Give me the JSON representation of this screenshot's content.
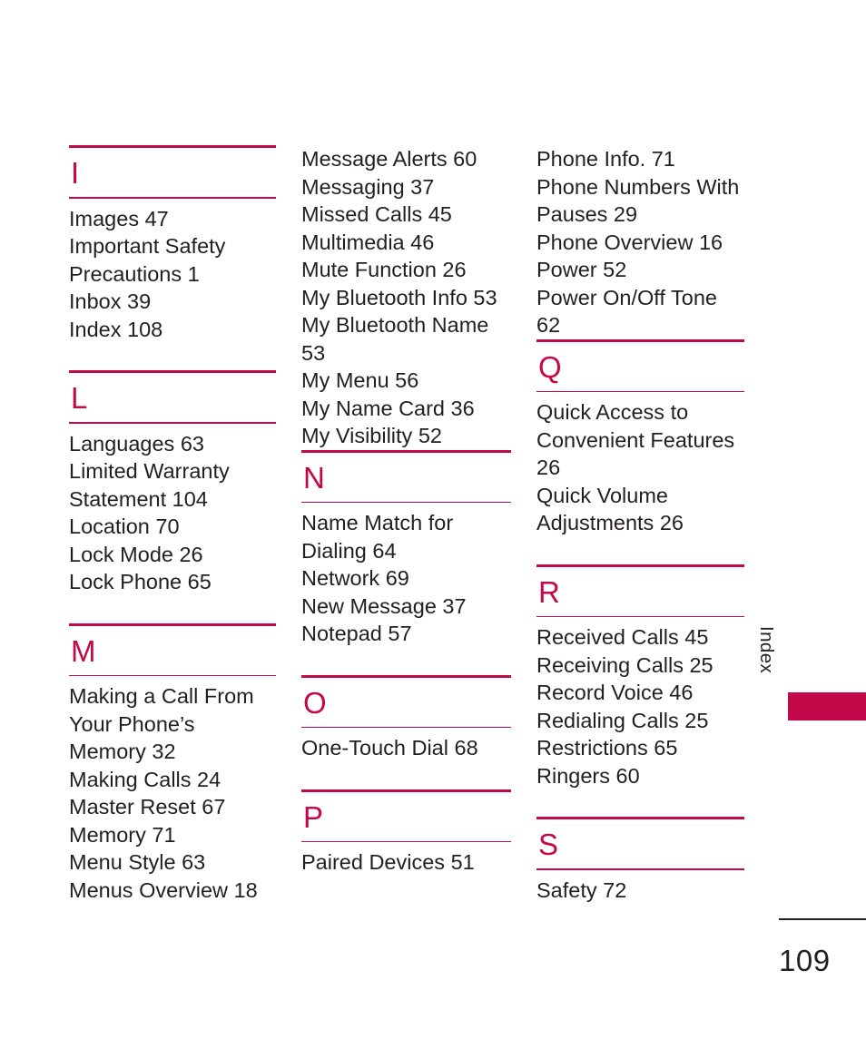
{
  "page": {
    "number": "109",
    "side_tab_label": "Index",
    "accent_color": "#c4094a",
    "text_color": "#231f20"
  },
  "columns": [
    {
      "id": "column-1",
      "sections": [
        {
          "letter": "I",
          "entries": [
            "Images 47",
            "Important Safety Precautions 1",
            "Inbox 39",
            "Index 108"
          ]
        },
        {
          "letter": "L",
          "entries": [
            "Languages 63",
            "Limited Warranty Statement 104",
            "Location 70",
            "Lock Mode 26",
            "Lock Phone 65"
          ]
        },
        {
          "letter": "M",
          "entries": [
            "Making a Call From Your Phone’s Memory 32",
            "Making Calls 24",
            "Master Reset 67",
            "Memory 71",
            "Menu Style 63",
            "Menus Overview 18"
          ]
        }
      ]
    },
    {
      "id": "column-2",
      "continued_entries": [
        "Message Alerts 60",
        "Messaging 37",
        "Missed Calls 45",
        "Multimedia 46",
        "Mute Function 26",
        "My Bluetooth Info 53",
        "My Bluetooth Name 53",
        "My Menu 56",
        "My Name Card 36",
        "My Visibility 52"
      ],
      "sections": [
        {
          "letter": "N",
          "entries": [
            "Name Match for Dialing 64",
            "Network 69",
            "New Message 37",
            "Notepad 57"
          ]
        },
        {
          "letter": "O",
          "entries": [
            "One-Touch Dial 68"
          ]
        },
        {
          "letter": "P",
          "entries": [
            "Paired Devices 51"
          ]
        }
      ]
    },
    {
      "id": "column-3",
      "continued_entries": [
        "Phone Info. 71",
        "Phone Numbers With Pauses 29",
        "Phone Overview 16",
        "Power 52",
        "Power On/Off Tone 62"
      ],
      "sections": [
        {
          "letter": "Q",
          "entries": [
            "Quick Access to Convenient Features 26",
            "Quick Volume Adjustments 26"
          ]
        },
        {
          "letter": "R",
          "entries": [
            "Received Calls 45",
            "Receiving Calls 25",
            "Record Voice 46",
            "Redialing Calls 25",
            "Restrictions 65",
            "Ringers 60"
          ]
        },
        {
          "letter": "S",
          "entries": [
            "Safety 72"
          ]
        }
      ]
    }
  ]
}
